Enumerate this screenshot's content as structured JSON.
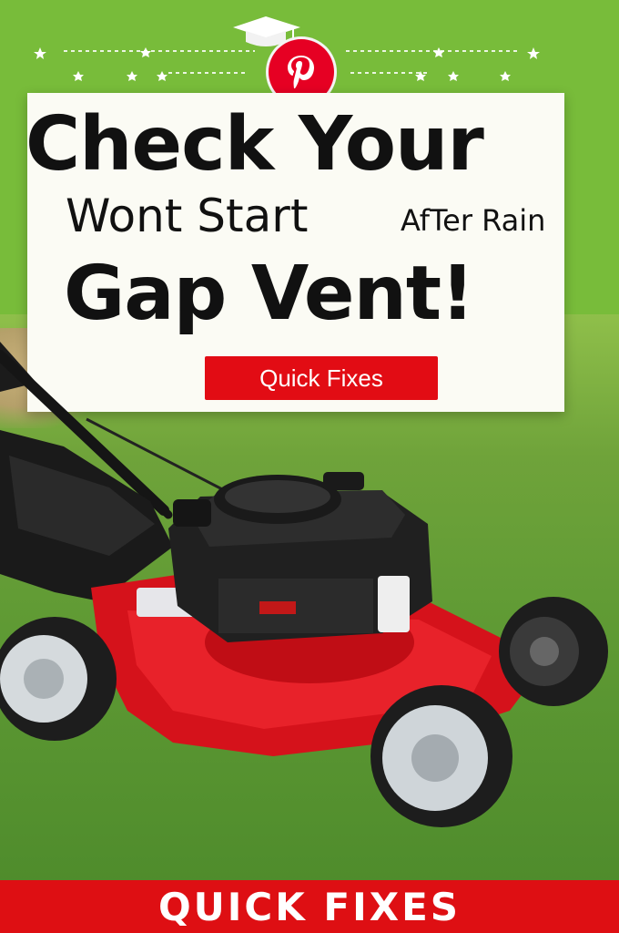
{
  "header": {
    "headline_line1": "Check Your",
    "headline_line2a": "Wont Start",
    "headline_line2b": "AfTer Rain",
    "headline_line3": "Gap Vent!"
  },
  "cta": {
    "label": "Quick Fixes"
  },
  "footer": {
    "label": "QUICK FIXES"
  },
  "icons": [
    "graduation-cap-icon",
    "pinterest-logo",
    "star-icon",
    "lawn-mower-image"
  ],
  "colors": {
    "green_bg": "#78bc3a",
    "red": "#e20c14",
    "card": "#fbfbf4",
    "text": "#111111"
  }
}
